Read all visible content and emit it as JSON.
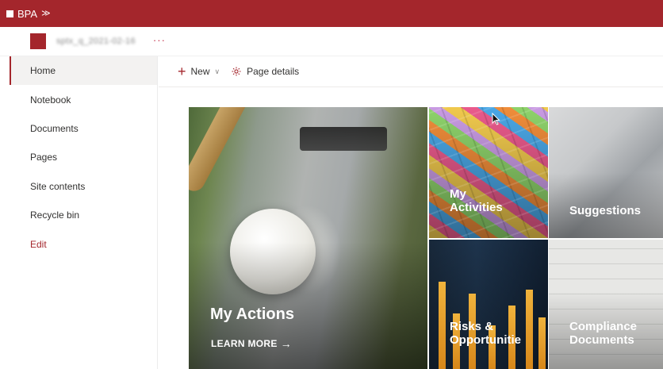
{
  "suite": {
    "title": "BPA",
    "chevron": "≫"
  },
  "site": {
    "name": "sptx_q_2021-02-16",
    "more": "···"
  },
  "nav": {
    "items": [
      {
        "label": "Home"
      },
      {
        "label": "Notebook"
      },
      {
        "label": "Documents"
      },
      {
        "label": "Pages"
      },
      {
        "label": "Site contents"
      },
      {
        "label": "Recycle bin"
      },
      {
        "label": "Edit"
      }
    ]
  },
  "command_bar": {
    "new_label": "New",
    "page_details_label": "Page details"
  },
  "hero": {
    "main": {
      "title": "My Actions",
      "link_label": "LEARN MORE",
      "link_arrow": "→"
    },
    "tiles": [
      {
        "title": "My Activities",
        "line1": "My",
        "line2": "Activities"
      },
      {
        "title": "Suggestions",
        "line1": "Suggestions"
      },
      {
        "title": "Risks & Opportunitie",
        "line1": "Risks &",
        "line2": "Opportunitie"
      },
      {
        "title": "Compliance Documents",
        "line1": "Compliance",
        "line2": "Documents"
      }
    ]
  },
  "colors": {
    "brand": "#a4262c",
    "nav_active_bg": "#f3f2f1"
  }
}
